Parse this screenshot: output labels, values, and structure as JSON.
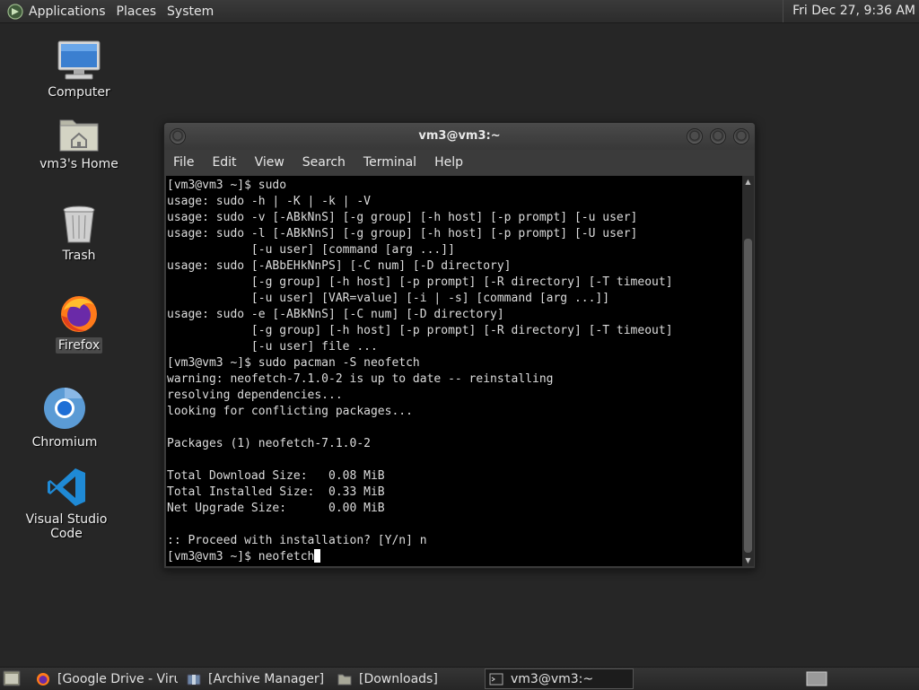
{
  "top_panel": {
    "menus": [
      "Applications",
      "Places",
      "System"
    ],
    "clock": "Fri Dec 27,  9:36 AM"
  },
  "desktop_icons": [
    {
      "label": "Computer",
      "icon": "computer-icon"
    },
    {
      "label": "vm3's Home",
      "icon": "home-folder-icon"
    },
    {
      "label": "Trash",
      "icon": "trash-icon"
    },
    {
      "label": "Firefox",
      "icon": "firefox-icon"
    },
    {
      "label": "Chromium",
      "icon": "chromium-icon"
    },
    {
      "label": "Visual Studio Code",
      "icon": "vscode-icon"
    }
  ],
  "terminal": {
    "title": "vm3@vm3:~",
    "menus": [
      "File",
      "Edit",
      "View",
      "Search",
      "Terminal",
      "Help"
    ],
    "lines": [
      "[vm3@vm3 ~]$ sudo",
      "usage: sudo -h | -K | -k | -V",
      "usage: sudo -v [-ABkNnS] [-g group] [-h host] [-p prompt] [-u user]",
      "usage: sudo -l [-ABkNnS] [-g group] [-h host] [-p prompt] [-U user]",
      "            [-u user] [command [arg ...]]",
      "usage: sudo [-ABbEHkNnPS] [-C num] [-D directory]",
      "            [-g group] [-h host] [-p prompt] [-R directory] [-T timeout]",
      "            [-u user] [VAR=value] [-i | -s] [command [arg ...]]",
      "usage: sudo -e [-ABkNnS] [-C num] [-D directory]",
      "            [-g group] [-h host] [-p prompt] [-R directory] [-T timeout]",
      "            [-u user] file ...",
      "[vm3@vm3 ~]$ sudo pacman -S neofetch",
      "warning: neofetch-7.1.0-2 is up to date -- reinstalling",
      "resolving dependencies...",
      "looking for conflicting packages...",
      "",
      "Packages (1) neofetch-7.1.0-2",
      "",
      "Total Download Size:   0.08 MiB",
      "Total Installed Size:  0.33 MiB",
      "Net Upgrade Size:      0.00 MiB",
      "",
      ":: Proceed with installation? [Y/n] n"
    ],
    "prompt_line": "[vm3@vm3 ~]$ neofetch"
  },
  "taskbar": {
    "tasks": [
      {
        "label": "[Google Drive - Viru...",
        "icon": "firefox-icon",
        "active": false
      },
      {
        "label": "[Archive Manager]",
        "icon": "archive-manager-icon",
        "active": false
      },
      {
        "label": "[Downloads]",
        "icon": "folder-icon",
        "active": false
      },
      {
        "label": "vm3@vm3:~",
        "icon": "terminal-icon",
        "active": true
      }
    ]
  }
}
